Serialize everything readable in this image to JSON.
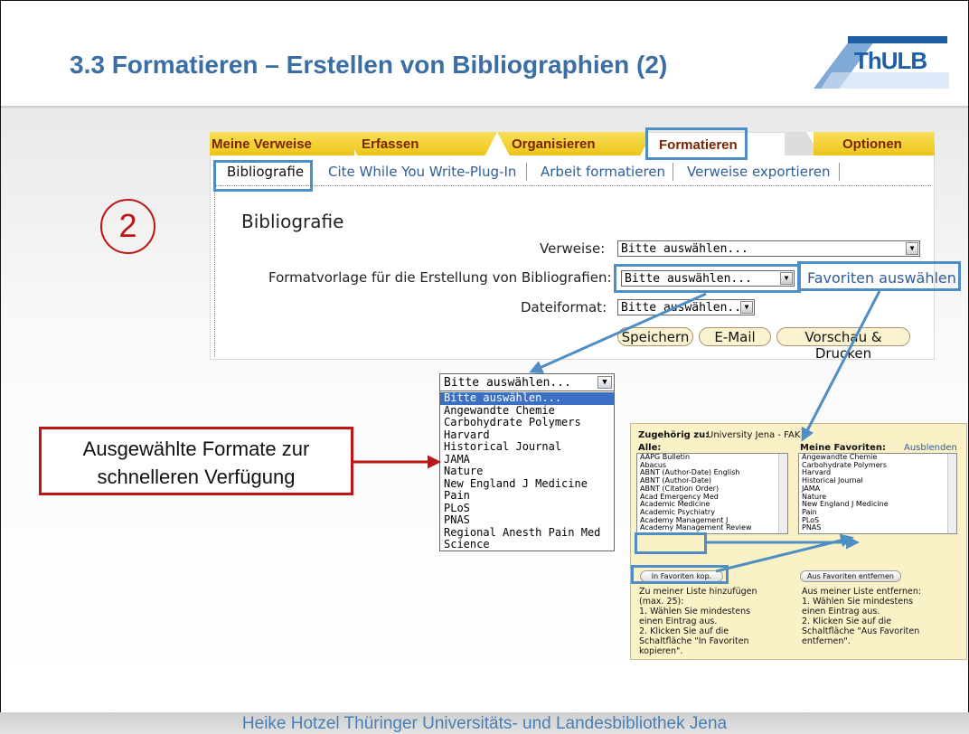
{
  "slide": {
    "title": "3.3 Formatieren – Erstellen von Bibliographien (2)",
    "logo_text": "ThULB",
    "step_number": "2",
    "footer": "Heike Hotzel   Thüringer Universitäts- und Landesbibliothek Jena",
    "callout_line1": "Ausgewählte  Formate zur",
    "callout_line2": "schnelleren Verfügung"
  },
  "tabs": [
    "Meine Verweise",
    "Erfassen",
    "Organisieren",
    "Formatieren",
    "Optionen"
  ],
  "subtabs": [
    "Bibliografie",
    "Cite While You Write-Plug-In",
    "Arbeit formatieren",
    "Verweise exportieren"
  ],
  "form": {
    "heading": "Bibliografie",
    "verweise_label": "Verweise:",
    "verweise_value": "Bitte auswählen...",
    "format_label": "Formatvorlage für die Erstellung von Bibliografien:",
    "format_value": "Bitte auswählen...",
    "favorites_link": "Favoriten auswählen",
    "dateiformat_label": "Dateiformat:",
    "dateiformat_value": "Bitte auswählen...",
    "buttons": [
      "Speichern",
      "E-Mail",
      "Vorschau & Drucken"
    ]
  },
  "dropdown": {
    "value": "Bitte auswählen...",
    "options": [
      "Bitte auswählen...",
      "Angewandte Chemie",
      "Carbohydrate Polymers",
      "Harvard",
      "Historical Journal",
      "JAMA",
      "Nature",
      "New England J Medicine",
      "Pain",
      "PLoS",
      "PNAS",
      "Regional Anesth Pain Med",
      "Science"
    ]
  },
  "favorites_panel": {
    "belongs_label": "Zugehörig zu:",
    "belongs_value": "University Jena - FAK",
    "all_label": "Alle:",
    "my_label": "Meine Favoriten:",
    "hide_link": "Ausblenden",
    "all_items": [
      "AAPG Bulletin",
      "Abacus",
      "ABNT (Author-Date) English",
      "ABNT (Author-Date)",
      "ABNT (Citation Order)",
      "Acad Emergency Med",
      "Academic Medicine",
      "Academic Psychiatry",
      "Academy Management J",
      "Academy Management Review"
    ],
    "my_items": [
      "Angewandte Chemie",
      "Carbohydrate Polymers",
      "Harvard",
      "Historical Journal",
      "JAMA",
      "Nature",
      "New England J Medicine",
      "Pain",
      "PLoS",
      "PNAS"
    ],
    "copy_button": "In Favoriten kop.",
    "remove_button": "Aus Favoriten entfernen",
    "help_add": "Zu meiner Liste hinzufügen\n(max. 25):\n1. Wählen Sie mindestens\neinen Eintrag aus.\n2. Klicken Sie auf die\nSchaltfläche \"In Favoriten\nkopieren\".",
    "help_remove": "Aus meiner Liste entfernen:\n1. Wählen Sie mindestens\neinen Eintrag aus.\n2. Klicken Sie auf die\nSchaltfläche \"Aus Favoriten\nentfernen\"."
  },
  "colors": {
    "title_blue": "#3a6ea5",
    "highlight_blue": "#4f8ec5",
    "callout_red": "#c01515",
    "tab_yellow": "#edc418",
    "panel_cream": "#fbf1c7"
  }
}
